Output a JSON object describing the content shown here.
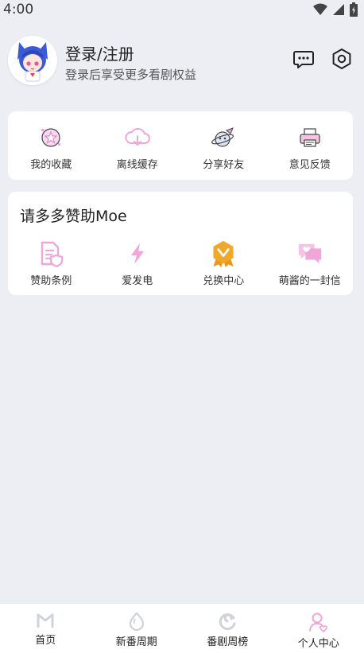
{
  "status": {
    "time": "4:00"
  },
  "user": {
    "login_title": "登录/注册",
    "login_subtitle": "登录后享受更多看剧权益"
  },
  "quick_actions": [
    {
      "label": "我的收藏",
      "icon": "star-badge-icon"
    },
    {
      "label": "离线缓存",
      "icon": "cloud-download-icon"
    },
    {
      "label": "分享好友",
      "icon": "planet-share-icon"
    },
    {
      "label": "意见反馈",
      "icon": "printer-feedback-icon"
    }
  ],
  "sponsor": {
    "title": "请多多赞助Moe",
    "items": [
      {
        "label": "赞助条例",
        "icon": "document-shield-icon"
      },
      {
        "label": "爱发电",
        "icon": "lightning-icon"
      },
      {
        "label": "兑换中心",
        "icon": "medal-badge-icon"
      },
      {
        "label": "萌酱的一封信",
        "icon": "heart-chat-icon"
      }
    ]
  },
  "tabs": [
    {
      "label": "首页",
      "icon": "home-m-icon"
    },
    {
      "label": "新番周期",
      "icon": "egg-icon"
    },
    {
      "label": "番剧周榜",
      "icon": "swirl-icon"
    },
    {
      "label": "个人中心",
      "icon": "person-heart-icon"
    }
  ],
  "colors": {
    "accent_pink": "#f0a6d8",
    "medal_gold": "#f0a82a",
    "background": "#eceef4"
  }
}
